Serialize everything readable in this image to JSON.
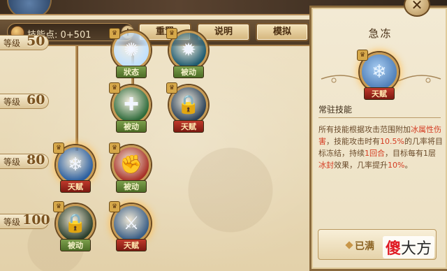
{
  "toolbar": {
    "skill_points_label": "技能点: 0+501",
    "plus_label": "+",
    "reset_label": "重置",
    "help_label": "说明",
    "simulate_label": "模拟"
  },
  "levels": [
    {
      "word": "等级",
      "num": "50"
    },
    {
      "word": "等级",
      "num": "60"
    },
    {
      "word": "等级",
      "num": "80"
    },
    {
      "word": "等级",
      "num": "100"
    }
  ],
  "nodes": [
    {
      "name": "node-l50-a",
      "tag": "狀态",
      "tag_color": "green",
      "icon": "burst-icon",
      "glyph": "✺",
      "bg": "#bfe0ff"
    },
    {
      "name": "node-l50-b",
      "tag": "被动",
      "tag_color": "green",
      "icon": "aura-icon",
      "glyph": "✹",
      "bg": "#1e5a6f"
    },
    {
      "name": "node-l60-a",
      "tag": "被动",
      "tag_color": "green",
      "icon": "heal-figure-icon",
      "glyph": "✚",
      "bg": "#2f6b3b"
    },
    {
      "name": "node-l60-b",
      "tag": "天赋",
      "tag_color": "red",
      "icon": "lock-icon",
      "glyph": "🔒",
      "bg": "#2c4258"
    },
    {
      "name": "node-l80-a",
      "tag": "天赋",
      "tag_color": "red",
      "icon": "frost-icon",
      "glyph": "❄",
      "bg": "#2b5fa0"
    },
    {
      "name": "node-l80-b",
      "tag": "被动",
      "tag_color": "green",
      "icon": "fist-icon",
      "glyph": "✊",
      "bg": "#a83228"
    },
    {
      "name": "node-l100-a",
      "tag": "被动",
      "tag_color": "green",
      "icon": "lock-icon",
      "glyph": "🔒",
      "bg": "#2b3f2c"
    },
    {
      "name": "node-l100-b",
      "tag": "天赋",
      "tag_color": "red",
      "icon": "warrior-icon",
      "glyph": "⚔",
      "bg": "#3a5e86"
    }
  ],
  "detail": {
    "title": "急冻",
    "icon_tag": "天赋",
    "type_label": "常驻技能",
    "desc_1": "所有技能根据攻击范围附加",
    "desc_hl_1": "冰属性伤害",
    "desc_2": "，技能攻击时有",
    "desc_hl_2": "10.5%",
    "desc_3": "的几率将目标冻结，持续",
    "desc_hl_3": "1回合",
    "desc_4": "，目标每有1层",
    "desc_hl_4": "冰封",
    "desc_5": "效果，几率提升",
    "desc_hl_5": "10%",
    "desc_6": "。",
    "maxed_label": "已满",
    "close_label": "✕"
  },
  "watermark": {
    "red": "傻",
    "rest": "大方"
  }
}
